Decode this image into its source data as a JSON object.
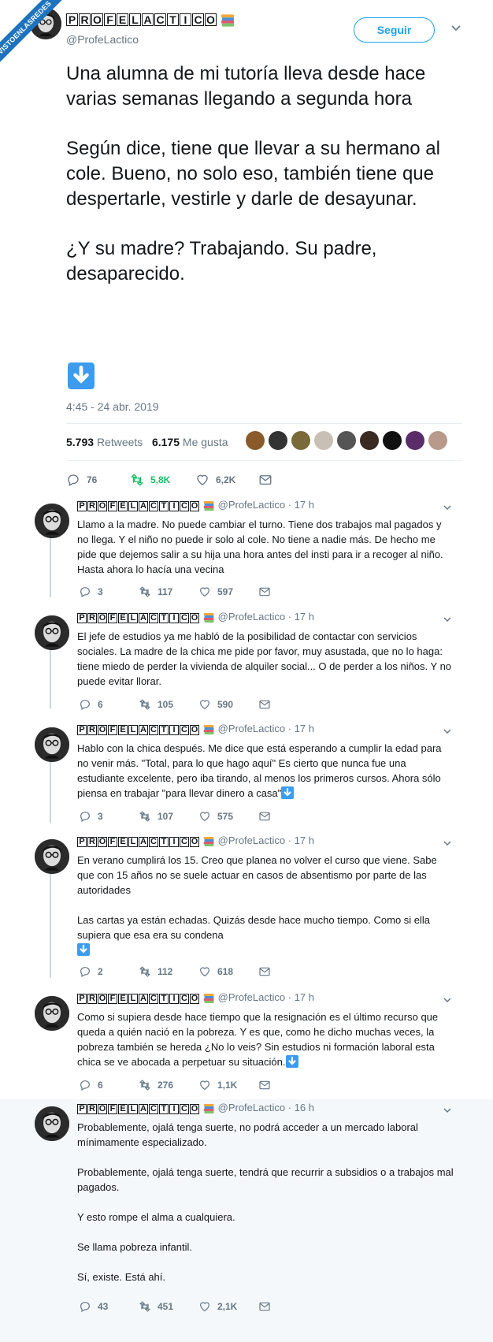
{
  "watermark": "VISTOENLASREDES",
  "author": {
    "name_letters": [
      "P",
      "R",
      "O",
      "F",
      "E",
      "L",
      "A",
      "C",
      "T",
      "I",
      "C",
      "O"
    ],
    "handle": "@ProfeLactico"
  },
  "follow_label": "Seguir",
  "main_tweet": {
    "paragraphs": [
      "Una alumna de mi tutoría lleva desde hace varias semanas llegando a segunda hora",
      "Según dice, tiene que llevar a su hermano al cole. Bueno, no solo eso, también tiene que despertarle, vestirle y darle de desayunar.",
      "¿Y su madre? Trabajando. Su padre, desaparecido."
    ],
    "date": "4:45 - 24 abr. 2019",
    "retweets_count": "5.793",
    "retweets_label": "Retweets",
    "likes_count": "6.175",
    "likes_label": "Me gusta",
    "actions": {
      "reply": "76",
      "retweet": "5,8K",
      "like": "6,2K"
    }
  },
  "replies": [
    {
      "time": "· 17 h",
      "paragraphs": [
        "Llamo a la madre. No puede cambiar el turno. Tiene dos trabajos mal pagados y no llega. Y el niño no puede ir solo al cole. No tiene a nadie más. De hecho me pide que dejemos salir a su hija una hora antes del insti para ir a recoger al niño. Hasta ahora lo hacía una vecina"
      ],
      "actions": {
        "reply": "3",
        "retweet": "117",
        "like": "597"
      }
    },
    {
      "time": "· 17 h",
      "paragraphs": [
        "El jefe de estudios ya me habló de la posibilidad de contactar con servicios sociales. La madre de la chica me pide por favor, muy asustada, que no lo haga: tiene miedo de perder la vivienda de alquiler social... O de perder a los niños. Y no puede evitar llorar."
      ],
      "actions": {
        "reply": "6",
        "retweet": "105",
        "like": "590"
      }
    },
    {
      "time": "· 17 h",
      "paragraphs": [
        "Hablo con la chica después. Me dice que está esperando a cumplir la edad para no venir más. \"Total, para lo que hago aquí\" Es cierto que nunca fue una estudiante excelente, pero iba tirando, al menos los primeros cursos. Ahora sólo piensa en trabajar \"para llevar dinero a casa\""
      ],
      "actions": {
        "reply": "3",
        "retweet": "107",
        "like": "575"
      }
    },
    {
      "time": "· 17 h",
      "paragraphs": [
        "En verano cumplirá los 15. Creo que planea no volver el curso que viene. Sabe que con 15 años no se suele actuar en casos de absentismo por parte de las autoridades",
        "Las cartas ya están echadas. Quizás desde hace mucho tiempo. Como si ella supiera que esa era su condena"
      ],
      "actions": {
        "reply": "2",
        "retweet": "112",
        "like": "618"
      }
    },
    {
      "time": "· 17 h",
      "paragraphs": [
        "Como si supiera desde hace tiempo que la resignación es el último recurso que queda a quién nació en la pobreza. Y es que, como he dicho muchas veces, la pobreza también se hereda ¿No lo veis? Sin estudios ni formación laboral esta chica se ve abocada a perpetuar su situación."
      ],
      "actions": {
        "reply": "6",
        "retweet": "276",
        "like": "1,1K"
      }
    },
    {
      "time": "· 16 h",
      "paragraphs": [
        "Probablemente, ojalá tenga suerte, no podrá acceder a un mercado laboral mínimamente especializado.",
        "Probablemente, ojalá tenga suerte, tendrá que recurrir a subsidios o a trabajos mal pagados.",
        "Y esto rompe el alma a cualquiera.",
        "Se llama pobreza infantil.",
        "Sí, existe. Está ahí."
      ],
      "actions": {
        "reply": "43",
        "retweet": "451",
        "like": "2,1K"
      }
    }
  ],
  "colors": {
    "accent": "#1da1f2",
    "retweet_green": "#17bf63",
    "text": "#14171a",
    "muted": "#657786",
    "emoji_blue": "#3b9cf0"
  },
  "icons": [
    "reply-icon",
    "retweet-icon",
    "like-icon",
    "message-icon",
    "chevron-down-icon",
    "books-emoji-icon",
    "arrow-down-emoji-icon"
  ]
}
